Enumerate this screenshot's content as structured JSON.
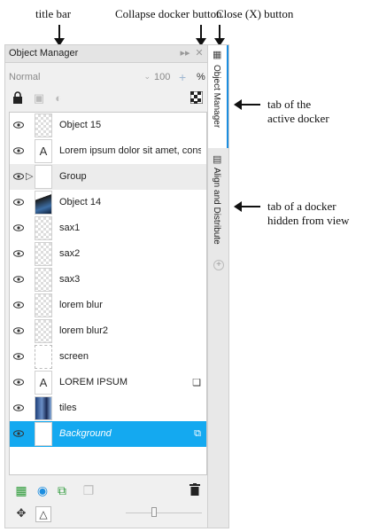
{
  "annotations": {
    "title_bar": "title bar",
    "collapse_button": "Collapse docker button",
    "close_button": "Close (X) button",
    "active_tab_line1": "tab of the",
    "active_tab_line2": "active docker",
    "hidden_tab_line1": "tab of a docker",
    "hidden_tab_line2": "hidden from view"
  },
  "docker": {
    "title": "Object Manager",
    "collapse_glyph": "▸▸",
    "close_glyph": "✕",
    "blend_mode": "Normal",
    "opacity": "100",
    "opacity_stepper": "+",
    "opacity_unit": "%",
    "toolbar_icons": [
      "lock-icon",
      "group-lock-icon",
      "visibility-icon",
      "checker-icon"
    ],
    "objects": [
      {
        "name": "Object 15",
        "thumb": "checker",
        "expander": "",
        "trailing": ""
      },
      {
        "name": "Lorem ipsum dolor sit amet, consecte…",
        "thumb": "text",
        "expander": "",
        "trailing": ""
      },
      {
        "name": "Group",
        "thumb": "plain",
        "expander": "▷",
        "trailing": ""
      },
      {
        "name": "Object 14",
        "thumb": "photo",
        "expander": "",
        "trailing": ""
      },
      {
        "name": "sax1",
        "thumb": "checker",
        "expander": "",
        "trailing": ""
      },
      {
        "name": "sax2",
        "thumb": "checker",
        "expander": "",
        "trailing": ""
      },
      {
        "name": "sax3",
        "thumb": "checker",
        "expander": "",
        "trailing": ""
      },
      {
        "name": "lorem blur",
        "thumb": "checker",
        "expander": "",
        "trailing": ""
      },
      {
        "name": "lorem blur2",
        "thumb": "checker",
        "expander": "",
        "trailing": ""
      },
      {
        "name": "screen",
        "thumb": "screen",
        "expander": "",
        "trailing": ""
      },
      {
        "name": "LOREM IPSUM",
        "thumb": "text",
        "expander": "",
        "trailing": "❏"
      },
      {
        "name": "tiles",
        "thumb": "tiles",
        "expander": "",
        "trailing": ""
      },
      {
        "name": "Background",
        "thumb": "plain",
        "expander": "",
        "trailing": "⧉"
      }
    ],
    "selected_index": 12,
    "group_index": 2,
    "text_thumb_glyph": "A",
    "tabs": [
      {
        "label": "Object Manager",
        "icon": "object-manager-icon",
        "active": true
      },
      {
        "label": "Align and Distribute",
        "icon": "align-icon",
        "active": false
      }
    ],
    "add_tab_glyph": "+"
  },
  "colors": {
    "selection": "#14a9f0",
    "active_tab_accent": "#1c8ee0",
    "new_layer_green": "#2e9b3a",
    "new_master_blue": "#1c8ee0"
  }
}
